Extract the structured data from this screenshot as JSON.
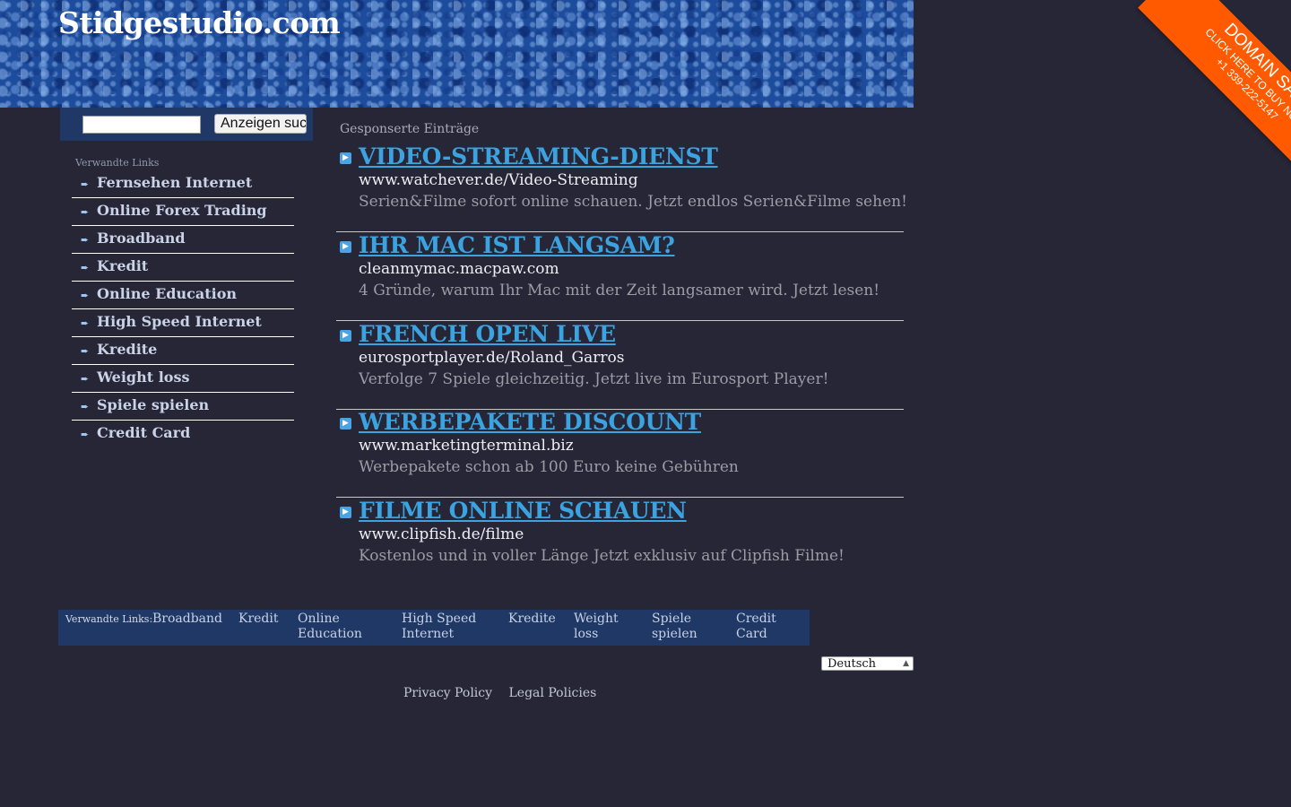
{
  "header": {
    "title": "Stidgestudio.com"
  },
  "ribbon": {
    "line1": "DOMAIN SALE",
    "line2": "CLICK HERE TO BUY NOW!",
    "line3": "+1 339-222-5147"
  },
  "search": {
    "value": "",
    "button_label": "Anzeigen suchen"
  },
  "sidebar": {
    "heading": "Verwandte Links",
    "items": [
      "Fernsehen Internet",
      "Online Forex Trading",
      "Broadband",
      "Kredit",
      "Online Education",
      "High Speed Internet",
      "Kredite",
      "Weight loss",
      "Spiele spielen",
      "Credit Card"
    ]
  },
  "main": {
    "heading": "Gesponserte Einträge",
    "ads": [
      {
        "title": "VIDEO-STREAMING-DIENST",
        "url": "www.watchever.de/Video-Streaming",
        "desc": "Serien&Filme sofort online schauen. Jetzt endlos Serien&Filme sehen!"
      },
      {
        "title": "IHR MAC IST LANGSAM?",
        "url": "cleanmymac.macpaw.com",
        "desc": "4 Gründe, warum Ihr Mac mit der Zeit langsamer wird. Jetzt lesen!"
      },
      {
        "title": "FRENCH OPEN LIVE",
        "url": "eurosportplayer.de/Roland_Garros",
        "desc": "Verfolge 7 Spiele gleichzeitig. Jetzt live im Eurosport Player!"
      },
      {
        "title": "WERBEPAKETE DISCOUNT",
        "url": "www.marketingterminal.biz",
        "desc": "Werbepakete schon ab 100 Euro keine Gebühren"
      },
      {
        "title": "FILME ONLINE SCHAUEN",
        "url": "www.clipfish.de/filme",
        "desc": "Kostenlos und in voller Länge Jetzt exklusiv auf Clipfish Filme!"
      }
    ]
  },
  "footer": {
    "label": "Verwandte Links:",
    "links": [
      [
        "Broadband",
        ""
      ],
      [
        "Kredit",
        ""
      ],
      [
        "Online",
        "Education"
      ],
      [
        "High Speed",
        "Internet"
      ],
      [
        "Kredite",
        ""
      ],
      [
        "Weight",
        "loss"
      ],
      [
        "Spiele",
        "spielen"
      ],
      [
        "Credit",
        "Card"
      ]
    ],
    "language": "Deutsch",
    "privacy": "Privacy Policy",
    "legal": "Legal Policies"
  },
  "colors": {
    "background": "#262636",
    "accent": "#3aa3e0",
    "ribbon": "#ff5a00",
    "panel": "#1f3866"
  }
}
